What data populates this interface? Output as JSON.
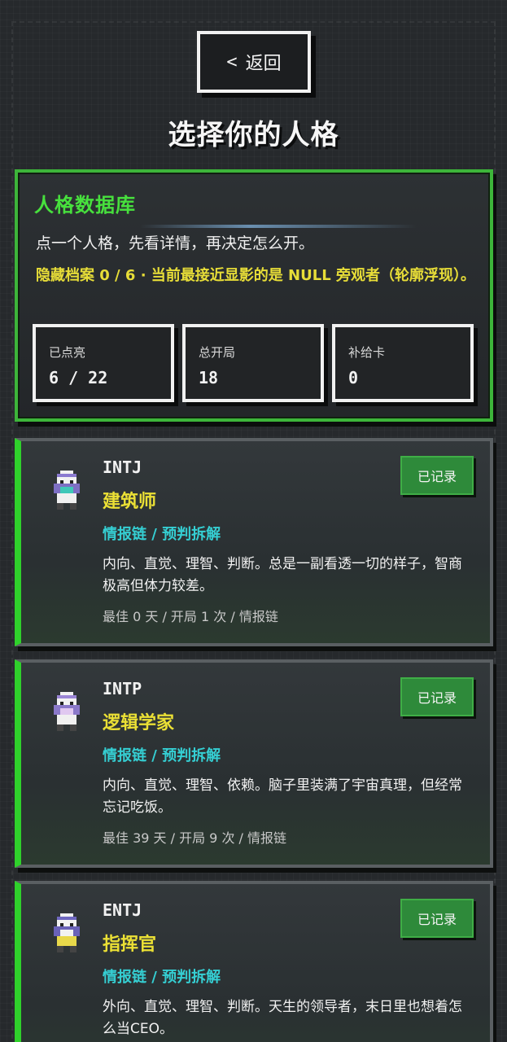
{
  "header": {
    "back_chevron": "<",
    "back_label": "返回",
    "title": "选择你的人格"
  },
  "database": {
    "title": "人格数据库",
    "description": "点一个人格，先看详情，再决定怎么开。",
    "hidden_info": "隐藏档案 0 / 6 · 当前最接近显影的是 NULL 旁观者（轮廓浮现）。",
    "stats": [
      {
        "label": "已点亮",
        "value": "6 / 22"
      },
      {
        "label": "总开局",
        "value": "18"
      },
      {
        "label": "补给卡",
        "value": "0"
      }
    ]
  },
  "personas": [
    {
      "code": "INTJ",
      "name": "建筑师",
      "tags": "情报链 / 预判拆解",
      "description": "内向、直觉、理智、判断。总是一副看透一切的样子，智商极高但体力较差。",
      "meta": "最佳 0 天 / 开局 1 次 / 情报链",
      "badge": "已记录",
      "avatar_icon": "pixel-character-icon"
    },
    {
      "code": "INTP",
      "name": "逻辑学家",
      "tags": "情报链 / 预判拆解",
      "description": "内向、直觉、理智、依赖。脑子里装满了宇宙真理，但经常忘记吃饭。",
      "meta": "最佳 39 天 / 开局 9 次 / 情报链",
      "badge": "已记录",
      "avatar_icon": "pixel-character-icon"
    },
    {
      "code": "ENTJ",
      "name": "指挥官",
      "tags": "情报链 / 预判拆解",
      "description": "外向、直觉、理智、判断。天生的领导者，末日里也想着怎么当CEO。",
      "meta": "",
      "badge": "已记录",
      "avatar_icon": "pixel-character-icon"
    }
  ],
  "colors": {
    "accent_green": "#3db53a",
    "title_green": "#47e03d",
    "name_yellow": "#ebe035",
    "tag_cyan": "#35cfd3",
    "badge_green": "#2e8a3a"
  }
}
